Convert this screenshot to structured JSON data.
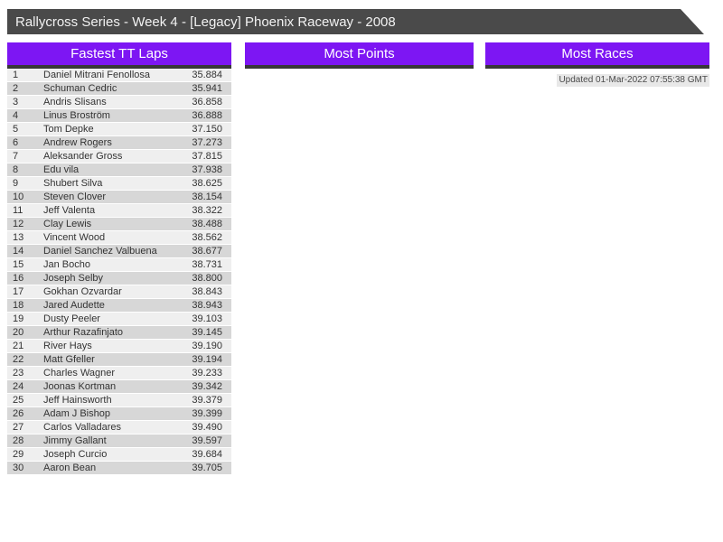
{
  "title_bar": {
    "title": "Rallycross Series - Week 4 - [Legacy] Phoenix Raceway - 2008"
  },
  "colors": {
    "accent_purple": "#7d16f3",
    "titlebar_gray": "#4a4a4a",
    "shadow_gray": "#383838",
    "row_light": "#efefef",
    "row_dark": "#d7d7d7"
  },
  "sections": {
    "fastest_tt_laps": {
      "header": "Fastest TT Laps",
      "rows": [
        {
          "rank": "1",
          "name": "Daniel Mitrani Fenollosa",
          "time": "35.884"
        },
        {
          "rank": "2",
          "name": "Schuman Cedric",
          "time": "35.941"
        },
        {
          "rank": "3",
          "name": "Andris Slisans",
          "time": "36.858"
        },
        {
          "rank": "4",
          "name": "Linus Broström",
          "time": "36.888"
        },
        {
          "rank": "5",
          "name": "Tom Depke",
          "time": "37.150"
        },
        {
          "rank": "6",
          "name": "Andrew Rogers",
          "time": "37.273"
        },
        {
          "rank": "7",
          "name": "Aleksander Gross",
          "time": "37.815"
        },
        {
          "rank": "8",
          "name": "Edu vila",
          "time": "37.938"
        },
        {
          "rank": "9",
          "name": "Shubert Silva",
          "time": "38.625"
        },
        {
          "rank": "10",
          "name": "Steven Clover",
          "time": "38.154"
        },
        {
          "rank": "11",
          "name": "Jeff Valenta",
          "time": "38.322"
        },
        {
          "rank": "12",
          "name": "Clay Lewis",
          "time": "38.488"
        },
        {
          "rank": "13",
          "name": "Vincent Wood",
          "time": "38.562"
        },
        {
          "rank": "14",
          "name": "Daniel Sanchez Valbuena",
          "time": "38.677"
        },
        {
          "rank": "15",
          "name": "Jan Bocho",
          "time": "38.731"
        },
        {
          "rank": "16",
          "name": "Joseph Selby",
          "time": "38.800"
        },
        {
          "rank": "17",
          "name": "Gokhan Ozvardar",
          "time": "38.843"
        },
        {
          "rank": "18",
          "name": "Jared Audette",
          "time": "38.943"
        },
        {
          "rank": "19",
          "name": "Dusty Peeler",
          "time": "39.103"
        },
        {
          "rank": "20",
          "name": "Arthur Razafinjato",
          "time": "39.145"
        },
        {
          "rank": "21",
          "name": "River Hays",
          "time": "39.190"
        },
        {
          "rank": "22",
          "name": "Matt Gfeller",
          "time": "39.194"
        },
        {
          "rank": "23",
          "name": "Charles Wagner",
          "time": "39.233"
        },
        {
          "rank": "24",
          "name": "Joonas Kortman",
          "time": "39.342"
        },
        {
          "rank": "25",
          "name": "Jeff Hainsworth",
          "time": "39.379"
        },
        {
          "rank": "26",
          "name": "Adam J Bishop",
          "time": "39.399"
        },
        {
          "rank": "27",
          "name": "Carlos Valladares",
          "time": "39.490"
        },
        {
          "rank": "28",
          "name": "Jimmy Gallant",
          "time": "39.597"
        },
        {
          "rank": "29",
          "name": "Joseph Curcio",
          "time": "39.684"
        },
        {
          "rank": "30",
          "name": "Aaron Bean",
          "time": "39.705"
        }
      ]
    },
    "most_points": {
      "header": "Most Points"
    },
    "most_races": {
      "header": "Most Races",
      "updated": "Updated 01-Mar-2022 07:55:38 GMT"
    }
  }
}
